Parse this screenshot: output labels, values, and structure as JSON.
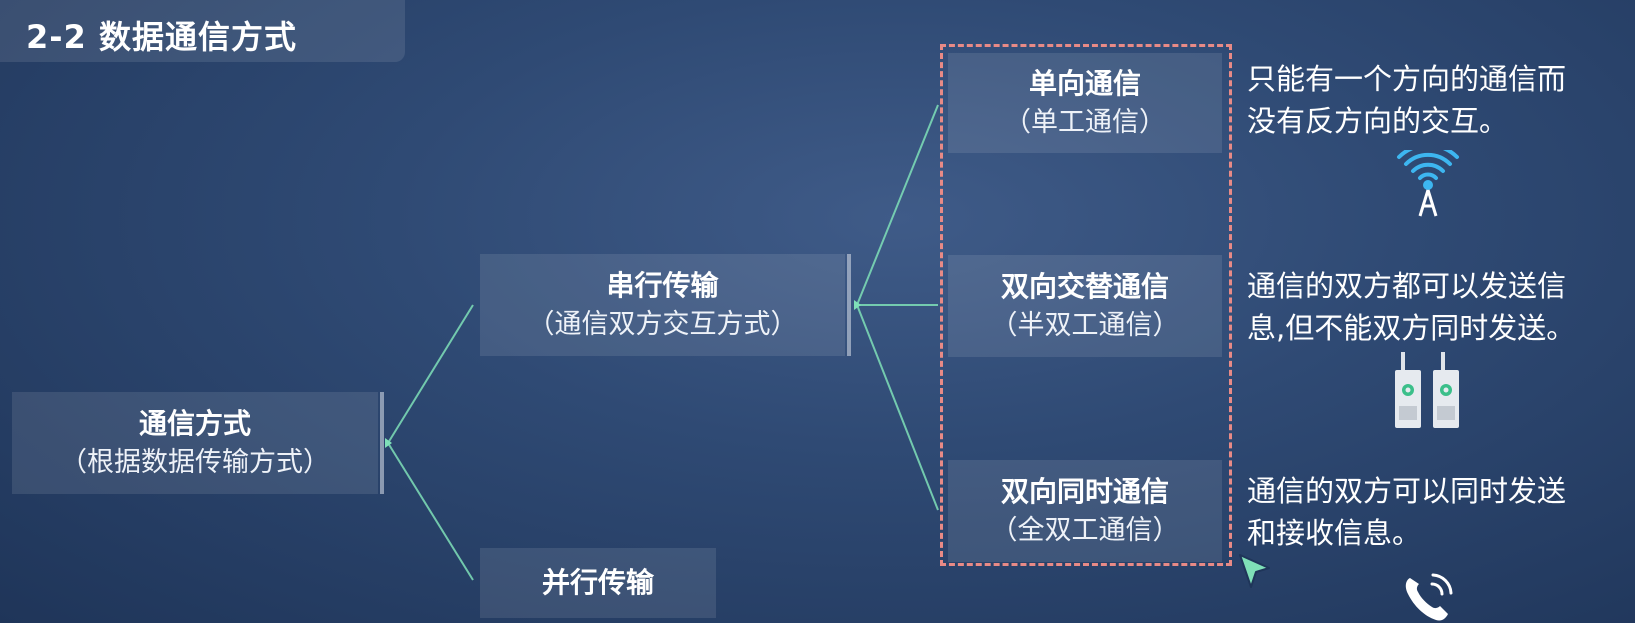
{
  "title": "2-2 数据通信方式",
  "root": {
    "label": "通信方式",
    "sub": "（根据数据传输方式）"
  },
  "serial": {
    "label": "串行传输",
    "sub": "（通信双方交互方式）"
  },
  "parallel": {
    "label": "并行传输"
  },
  "modes": [
    {
      "label": "单向通信",
      "sub": "（单工通信）",
      "desc_line1": "只能有一个方向的通信而",
      "desc_line2": "没有反方向的交互。",
      "icon": "radio-tower-icon"
    },
    {
      "label": "双向交替通信",
      "sub": "（半双工通信）",
      "desc_line1": "通信的双方都可以发送信",
      "desc_line2": "息,但不能双方同时发送。",
      "icon": "walkie-talkie-icon"
    },
    {
      "label": "双向同时通信",
      "sub": "（全双工通信）",
      "desc_line1": "通信的双方可以同时发送",
      "desc_line2": "和接收信息。",
      "icon": "phone-icon"
    }
  ],
  "colors": {
    "connector": "#7fe0b8",
    "highlight_border": "#e88a86",
    "icon_accent": "#3db6f0"
  }
}
